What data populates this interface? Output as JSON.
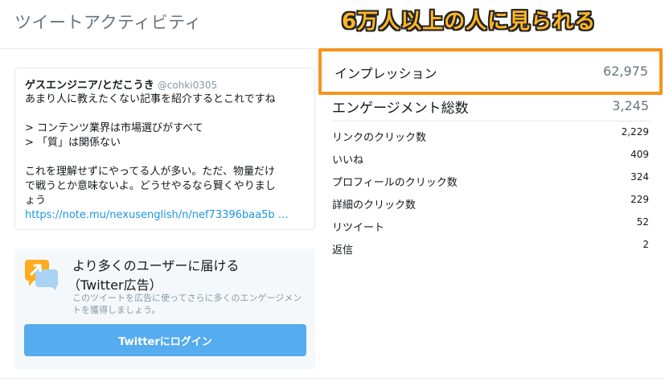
{
  "header": {
    "title": "ツイートアクティビティ"
  },
  "annotation": {
    "text": "6万人以上の人に見られる",
    "color": "#ffb526",
    "highlight_color": "#f7931e"
  },
  "tweet": {
    "author_name": "ゲスエンジニア/とだこうき",
    "author_handle": "@cohki0305",
    "lines": [
      "あまり人に教えたくない記事を紹介するとこれですね",
      "",
      "> コンテンツ業界は市場選びがすべて",
      "> 「質」は関係ない",
      "",
      "これを理解せずにやってる人が多い。ただ、物量だけ",
      "で戦うとか意味ないよ。どうせやるなら賢くやりまし",
      "ょう"
    ],
    "link": "https://note.mu/nexusenglish/n/nef73396baa5b …"
  },
  "promo": {
    "title_line1": "より多くのユーザーに届ける",
    "title_line2": "（Twitter広告）",
    "description": "このツイートを広告に使ってさらに多くのエンゲージメントを獲得しましょう。",
    "button_label": "Twitterにログイン",
    "icon": "promote-icon"
  },
  "metrics": {
    "impressions": {
      "label": "インプレッション",
      "value": "62,975"
    },
    "engagements": {
      "label": "エンゲージメント総数",
      "value": "3,245"
    },
    "items": [
      {
        "label": "リンクのクリック数",
        "value": "2,229"
      },
      {
        "label": "いいね",
        "value": "409"
      },
      {
        "label": "プロフィールのクリック数",
        "value": "324"
      },
      {
        "label": "詳細のクリック数",
        "value": "229"
      },
      {
        "label": "リツイート",
        "value": "52"
      },
      {
        "label": "返信",
        "value": "2"
      }
    ]
  }
}
